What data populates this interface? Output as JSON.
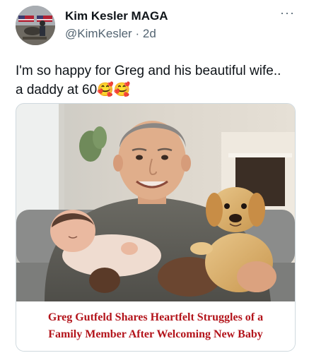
{
  "post": {
    "author": {
      "display_name": "Kim Kesler  MAGA",
      "handle": "@KimKesler",
      "separator": "·",
      "time_ago": "2d"
    },
    "more_icon": "more-horizontal-icon",
    "text_line1": "I'm so happy for Greg and his beautiful wife..",
    "text_line2": "a daddy at 60",
    "emojis": "🥰🥰",
    "media": {
      "caption_line1": "Greg Gutfeld Shares Heartfelt Struggles of a",
      "caption_line2": "Family Member After Welcoming New Baby",
      "caption_color": "#b3141b"
    }
  },
  "colors": {
    "text": "#0f1419",
    "muted": "#536471",
    "border": "#cfd9de"
  }
}
